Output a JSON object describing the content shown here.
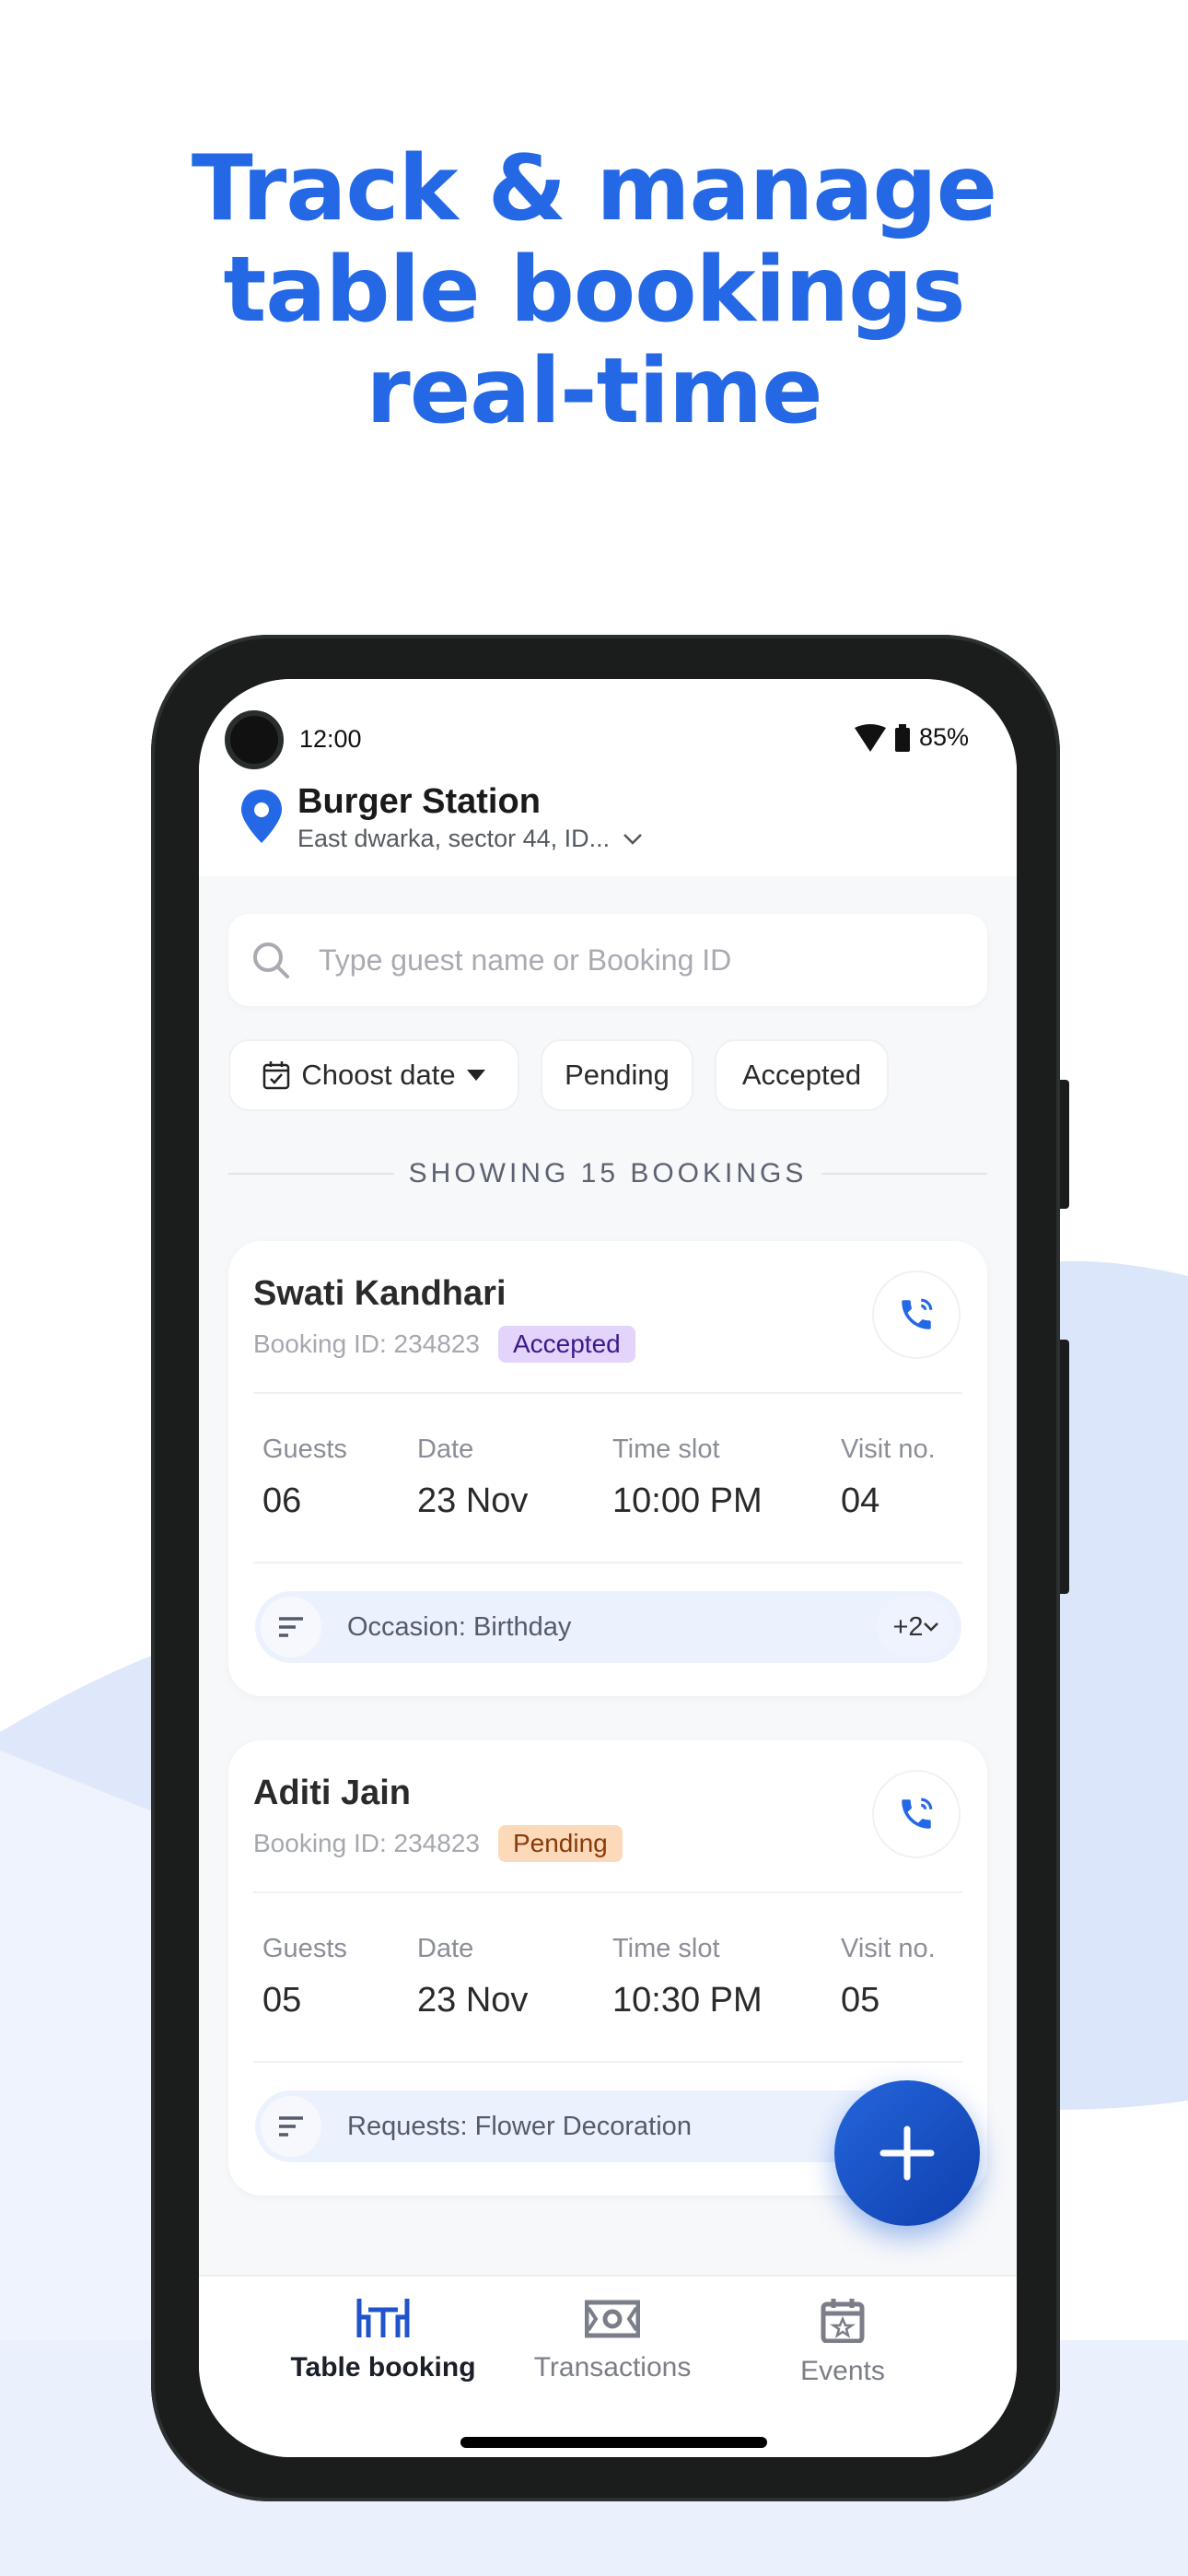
{
  "headline": [
    "Track & manage",
    "table bookings",
    "real-time"
  ],
  "colors": {
    "brand": "#2468e6",
    "accepted_bg": "#e2d4fa",
    "accepted_text": "#3b1a8a",
    "pending_bg": "#fcd9b8",
    "pending_text": "#8a3a0a"
  },
  "status_bar": {
    "time": "12:00",
    "battery": "85%"
  },
  "header": {
    "restaurant": "Burger Station",
    "address": "East dwarka, sector 44, ID..."
  },
  "search": {
    "placeholder": "Type guest name or Booking ID",
    "value": ""
  },
  "filters": {
    "date": "Choost date",
    "pending": "Pending",
    "accepted": "Accepted"
  },
  "summary": "SHOWING 15 BOOKINGS",
  "labels": {
    "guests": "Guests",
    "date": "Date",
    "time_slot": "Time slot",
    "visit": "Visit no."
  },
  "bookings": [
    {
      "name": "Swati Kandhari",
      "booking_id": "Booking ID: 234823",
      "status": "Accepted",
      "guests": "06",
      "date": "23 Nov",
      "time": "10:00 PM",
      "visit": "04",
      "note": "Occasion: Birthday",
      "more": "+2"
    },
    {
      "name": "Aditi Jain",
      "booking_id": "Booking ID: 234823",
      "status": "Pending",
      "guests": "05",
      "date": "23 Nov",
      "time": "10:30 PM",
      "visit": "05",
      "note": "Requests: Flower Decoration"
    }
  ],
  "nav": [
    {
      "label": "Table booking",
      "icon": "table-icon",
      "active": true
    },
    {
      "label": "Transactions",
      "icon": "cash-icon"
    },
    {
      "label": "Events",
      "icon": "calendar-star-icon"
    }
  ]
}
